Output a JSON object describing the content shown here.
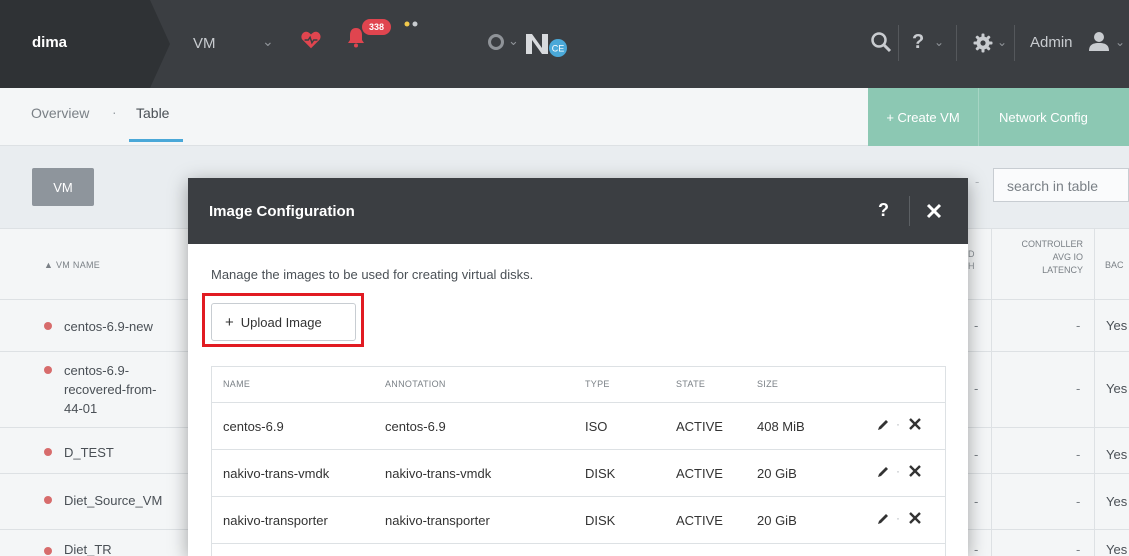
{
  "topbar": {
    "cluster_name": "dima",
    "menu_label": "VM",
    "alert_count": "338",
    "admin_label": "Admin",
    "logo_badge": "CE"
  },
  "subnav": {
    "overview_label": "Overview",
    "separator": "·",
    "table_label": "Table",
    "create_vm_label": "+ Create VM",
    "network_config_label": "Network Config"
  },
  "page": {
    "vm_button_label": "VM",
    "search_placeholder": "search in table",
    "dash": "-",
    "columns": {
      "vm_name": "▲ VM NAME",
      "partial_d": "D\nH",
      "controller_avg_io_latency": "CONTROLLER\nAVG IO\nLATENCY",
      "bac": "BAC"
    },
    "vms": [
      {
        "name": "centos-6.9-new",
        "latency": "-",
        "backup": "Yes"
      },
      {
        "name": "centos-6.9-\nrecovered-from-\n44-01",
        "latency": "-",
        "backup": "Yes"
      },
      {
        "name": "D_TEST",
        "latency": "-",
        "backup": "Yes"
      },
      {
        "name": "Diet_Source_VM",
        "latency": "-",
        "backup": "Yes"
      },
      {
        "name": "Diet_TR",
        "latency": "-",
        "backup": "Yes"
      }
    ]
  },
  "modal": {
    "title": "Image Configuration",
    "help": "?",
    "description": "Manage the images to be used for creating virtual disks.",
    "upload_button": "Upload Image",
    "upload_plus": "+",
    "columns": {
      "name": "NAME",
      "annotation": "ANNOTATION",
      "type": "TYPE",
      "state": "STATE",
      "size": "SIZE"
    },
    "images": [
      {
        "name": "centos-6.9",
        "annotation": "centos-6.9",
        "type": "ISO",
        "state": "ACTIVE",
        "size": "408 MiB"
      },
      {
        "name": "nakivo-trans-vmdk",
        "annotation": "nakivo-trans-vmdk",
        "type": "DISK",
        "state": "ACTIVE",
        "size": "20 GiB"
      },
      {
        "name": "nakivo-transporter",
        "annotation": "nakivo-transporter",
        "type": "DISK",
        "state": "ACTIVE",
        "size": "20 GiB"
      }
    ],
    "row_separator": "·"
  },
  "colors": {
    "topbar": "#3b3e42",
    "accent_green": "#8cc8b3",
    "alert_red": "#e0454f",
    "highlight_red": "#e11b22",
    "vm_status_dot": "#d76c6c"
  }
}
